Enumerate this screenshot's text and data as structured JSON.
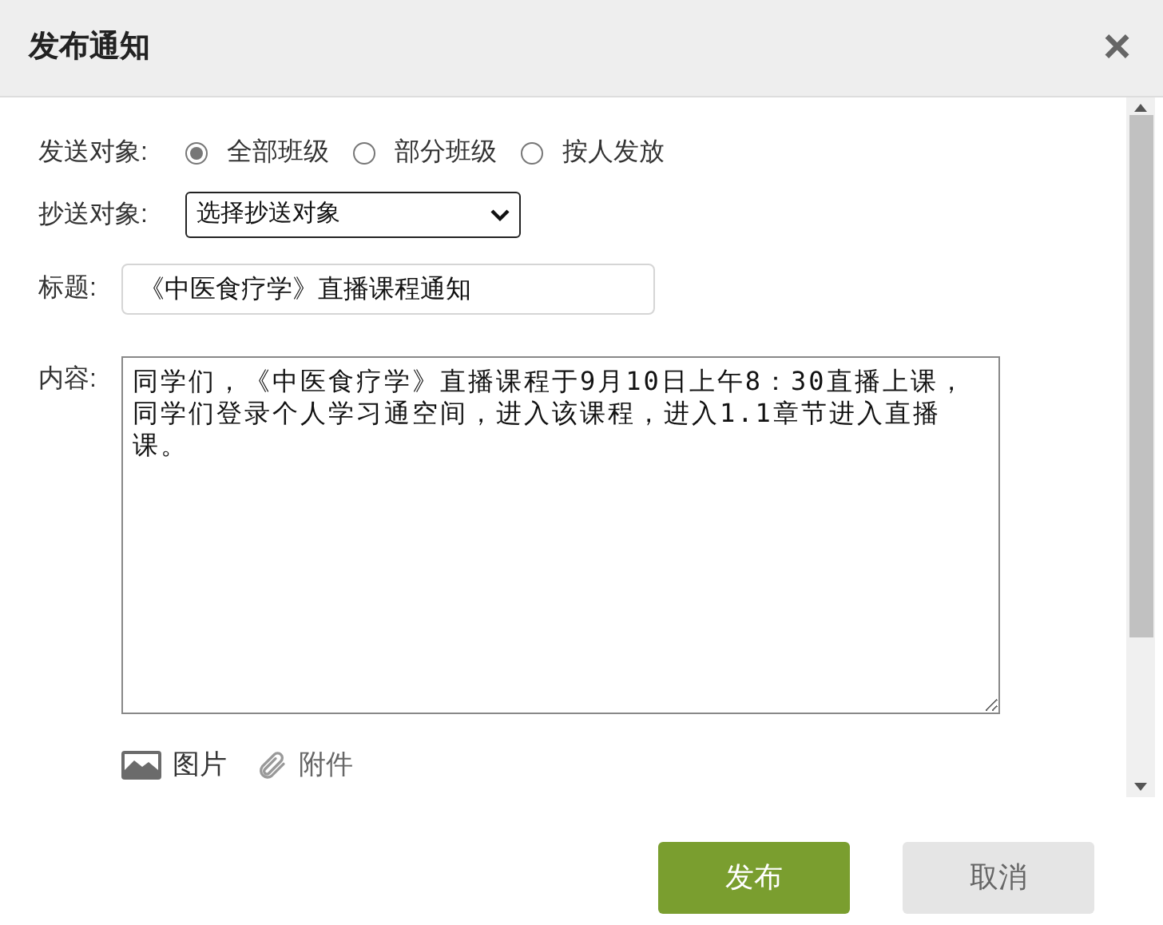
{
  "dialog": {
    "title": "发布通知",
    "close": "×"
  },
  "recipients": {
    "label": "发送对象:",
    "options": [
      {
        "label": "全部班级",
        "selected": true
      },
      {
        "label": "部分班级",
        "selected": false
      },
      {
        "label": "按人发放",
        "selected": false
      }
    ]
  },
  "cc": {
    "label": "抄送对象:",
    "value": "选择抄送对象"
  },
  "subject": {
    "label": "标题:",
    "value": "《中医食疗学》直播课程通知"
  },
  "content": {
    "label": "内容:",
    "value": "同学们，《中医食疗学》直播课程于9月10日上午8：30直播上课，同学们登录个人学习通空间，进入该课程，进入1.1章节进入直播课。"
  },
  "attachments": [
    {
      "kind": "image",
      "label": "图片"
    },
    {
      "kind": "file",
      "label": "附件"
    }
  ],
  "buttons": [
    {
      "kind": "primary",
      "label": "发布"
    },
    {
      "kind": "secondary",
      "label": "取消"
    }
  ]
}
